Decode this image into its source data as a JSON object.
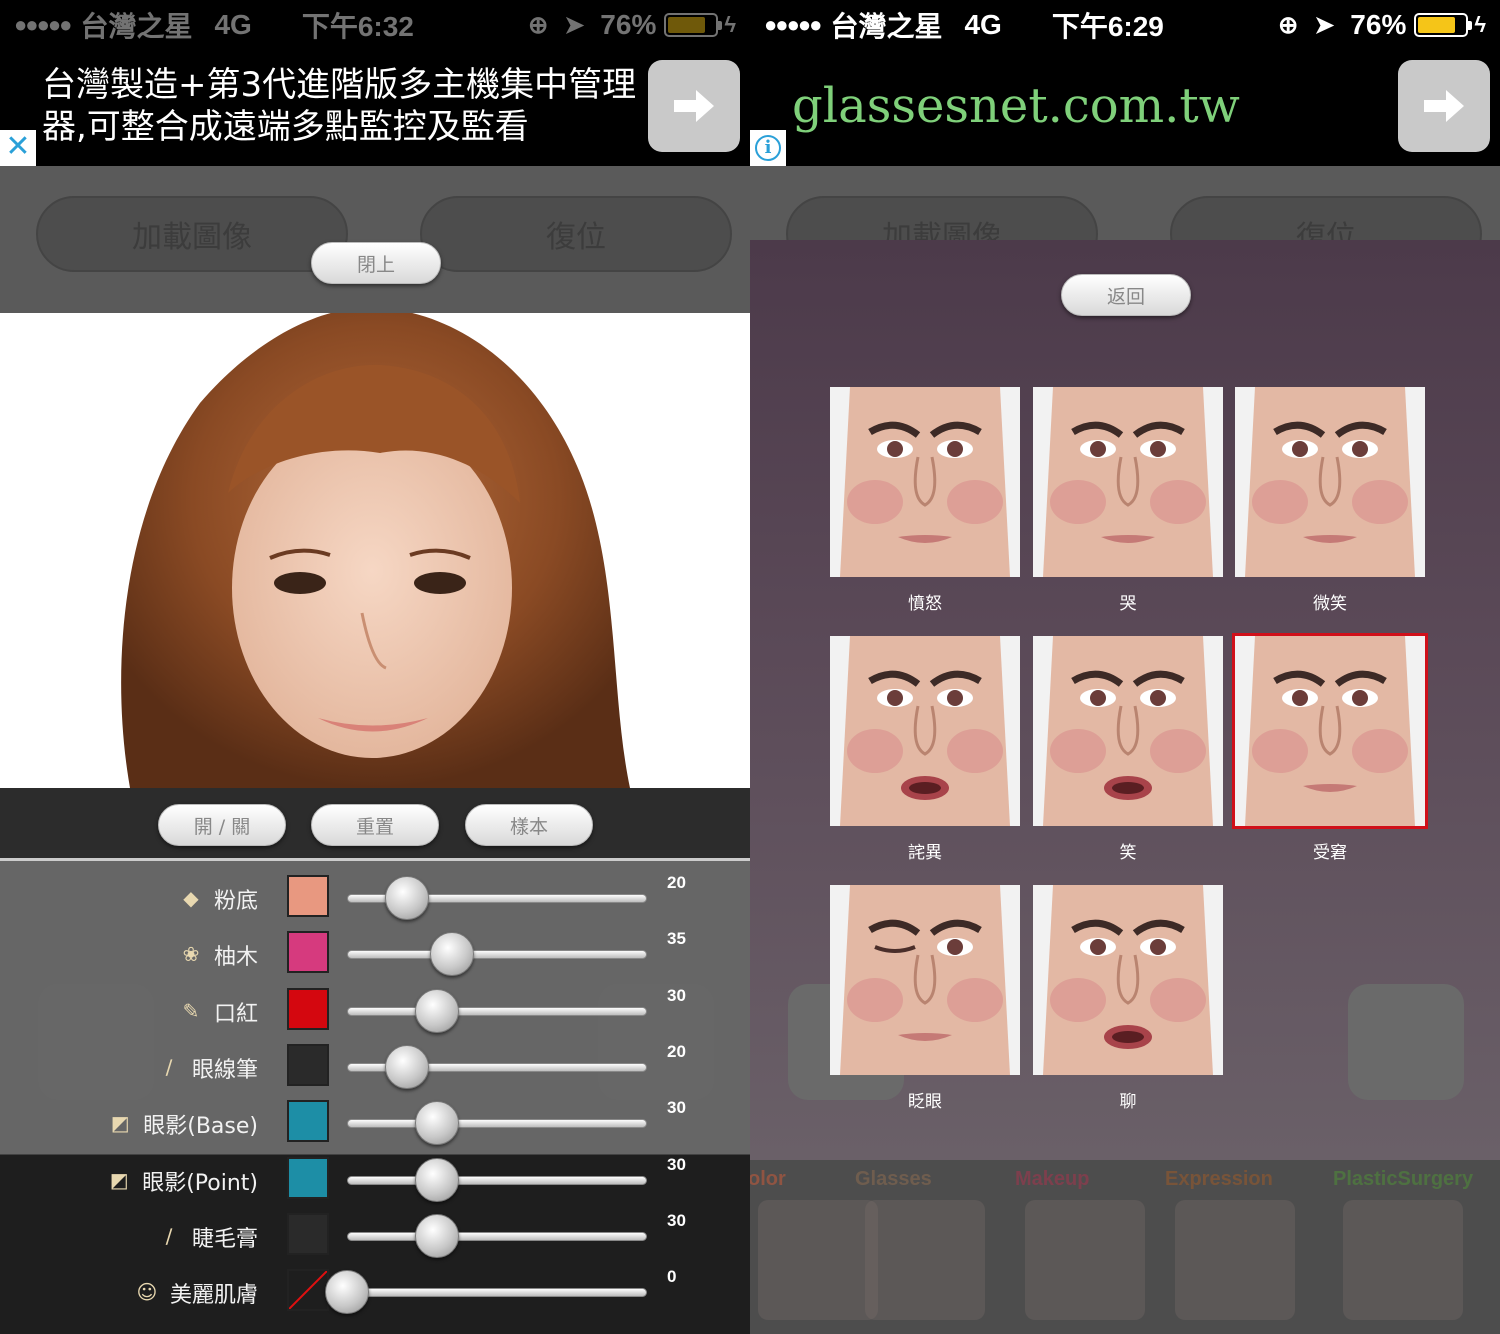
{
  "left": {
    "status": {
      "signal": "●●●●●",
      "carrier": "台灣之星",
      "network": "4G",
      "time": "下午6:32",
      "battery_percent": "76%",
      "battery_level": 0.76
    },
    "ad": {
      "text": "台灣製造+第3代進階版多主機集中管理器,可整合成遠端多點監控及監看",
      "close": "✕"
    },
    "toolbar": {
      "load_image": "加載圖像",
      "reset": "復位"
    },
    "close_button": "閉上",
    "makeup": {
      "buttons": {
        "toggle": "開 / 關",
        "reset": "重置",
        "sample": "樣本"
      },
      "items": [
        {
          "label": "粉底",
          "value": "20",
          "level": 20,
          "color": "#e89880"
        },
        {
          "label": "柚木",
          "value": "35",
          "level": 35,
          "color": "#d63a7e"
        },
        {
          "label": "口紅",
          "value": "30",
          "level": 30,
          "color": "#d4070f"
        },
        {
          "label": "眼線筆",
          "value": "20",
          "level": 20,
          "color": "#2a2a2a"
        },
        {
          "label": "眼影(Base)",
          "value": "30",
          "level": 30,
          "color": "#1d8ea6"
        },
        {
          "label": "眼影(Point)",
          "value": "30",
          "level": 30,
          "color": "#1d8ea6"
        },
        {
          "label": "睫毛膏",
          "value": "30",
          "level": 30,
          "color": "#2a2a2a"
        },
        {
          "label": "美麗肌膚",
          "value": "0",
          "level": 0,
          "color": "none"
        }
      ]
    }
  },
  "right": {
    "status": {
      "signal": "●●●●●",
      "carrier": "台灣之星",
      "network": "4G",
      "time": "下午6:29",
      "battery_percent": "76%",
      "battery_level": 0.76
    },
    "ad": {
      "domain": "glassesnet.com.tw"
    },
    "toolbar": {
      "load_image": "加載圖像",
      "reset": "復位"
    },
    "back_button": "返回",
    "expressions": [
      {
        "label": "憤怒",
        "selected": false
      },
      {
        "label": "哭",
        "selected": false
      },
      {
        "label": "微笑",
        "selected": false
      },
      {
        "label": "詫異",
        "selected": false
      },
      {
        "label": "笑",
        "selected": false
      },
      {
        "label": "受窘",
        "selected": true
      },
      {
        "label": "眨眼",
        "selected": false
      },
      {
        "label": "聊",
        "selected": false
      }
    ],
    "tabs": [
      {
        "label": "olor",
        "color": "#c85a3a"
      },
      {
        "label": "Glasses",
        "color": "#8b6b50"
      },
      {
        "label": "Makeup",
        "color": "#a5344d"
      },
      {
        "label": "Expression",
        "color": "#9c5a2a"
      },
      {
        "label": "PlasticSurgery",
        "color": "#4f8f38"
      }
    ]
  }
}
